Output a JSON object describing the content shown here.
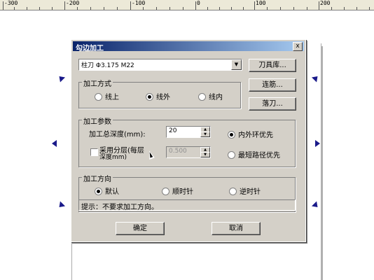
{
  "ruler": {
    "labels": [
      "-300",
      "-200",
      "-100",
      "0",
      "100",
      "200"
    ]
  },
  "dialog": {
    "title": "勾边加工",
    "close_label": "x",
    "tool_combo_value": "柱刀 Φ3.175 M22",
    "combo_arrow": "▼",
    "btn_tool_library": "刀具库...",
    "btn_link": "连筋...",
    "btn_drop": "落刀...",
    "group_method": {
      "legend": "加工方式",
      "options": [
        "线上",
        "线外",
        "线内"
      ],
      "selected": "线外"
    },
    "group_params": {
      "legend": "加工参数",
      "depth_label": "加工总深度(mm):",
      "depth_value": "20",
      "layer_label_1": "采用分层(每层",
      "layer_label_2": "深度mm)",
      "layer_value": "0.500",
      "order_options": [
        "内外环优先",
        "最短路径优先"
      ],
      "order_selected": "内外环优先"
    },
    "group_direction": {
      "legend": "加工方向",
      "options": [
        "默认",
        "顺时针",
        "逆时针"
      ],
      "selected": "默认"
    },
    "hint": "提示：不要求加工方向。",
    "ok_label": "确定",
    "cancel_label": "取消"
  }
}
